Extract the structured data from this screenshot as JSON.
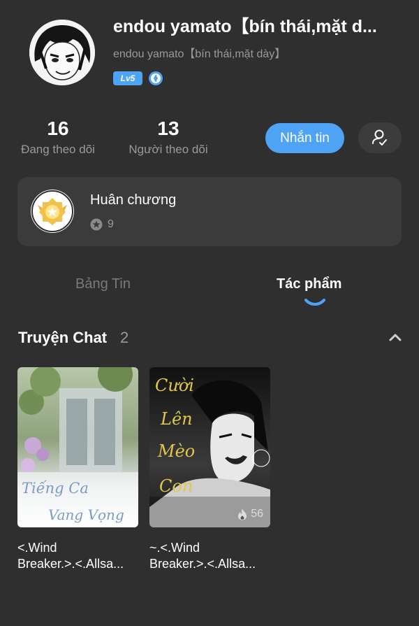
{
  "profile": {
    "display_name": "endou yamato【bín thái,mặt d...",
    "username": "endou yamato【bín thái,mặt dày】",
    "level": "Lv5"
  },
  "stats": {
    "following_count": "16",
    "following_label": "Đang theo dõi",
    "followers_count": "13",
    "followers_label": "Người theo dõi"
  },
  "actions": {
    "message_label": "Nhắn tin"
  },
  "medal": {
    "title": "Huân chương",
    "count": "9"
  },
  "tabs": [
    {
      "label": "Bảng Tin",
      "active": false
    },
    {
      "label": "Tác phẩm",
      "active": true
    }
  ],
  "section": {
    "title": "Truyện Chat",
    "count": "2"
  },
  "works": [
    {
      "cover_text": [
        "Tiếng Ca",
        "Vang Vọng"
      ],
      "title_line1": "<.Wind",
      "title_line2": "Breaker.>.<.Allsa..."
    },
    {
      "cover_text": [
        "Cười",
        "Lên",
        "Mèo",
        "Con"
      ],
      "views": "56",
      "title_line1": "~.<.Wind",
      "title_line2": "Breaker.>.<.Allsa..."
    }
  ],
  "colors": {
    "background": "#2f2f2f",
    "accent": "#4ea3f5",
    "card": "#3b3b3b",
    "muted_text": "#9a9a9a"
  }
}
